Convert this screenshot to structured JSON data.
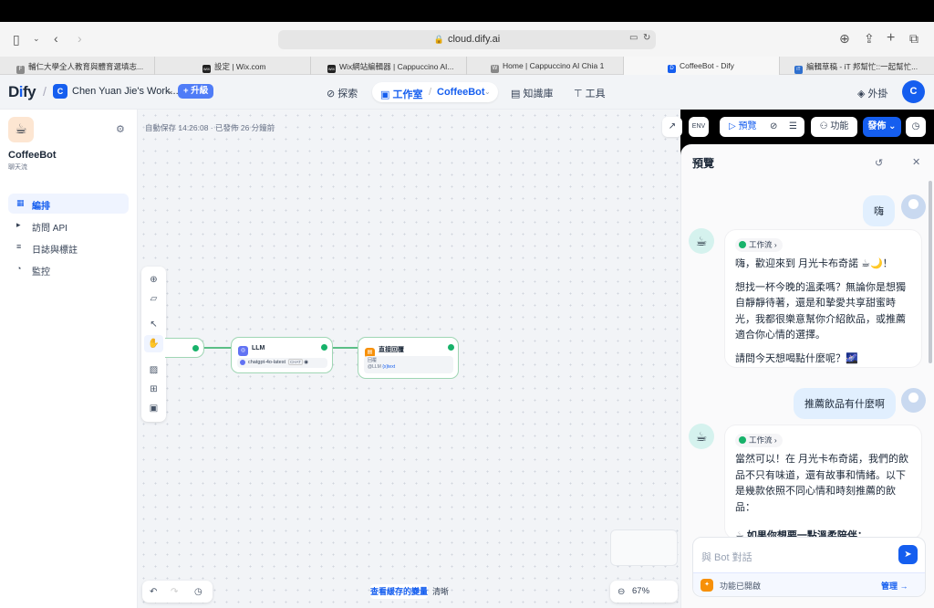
{
  "browser": {
    "url": "cloud.dify.ai",
    "tabs": [
      {
        "label": "輔仁大學全人教育與體育選填志...",
        "fav": "F",
        "fav_color": "#8a8a8a"
      },
      {
        "label": "設定 | Wix.com",
        "fav": "WiX",
        "fav_color": "#222222"
      },
      {
        "label": "Wix網站編輯器 | Cappuccino AI...",
        "fav": "WiX",
        "fav_color": "#222222"
      },
      {
        "label": "Home | Cappuccino AI Chia 1",
        "fav": "W",
        "fav_color": "#888888"
      },
      {
        "label": "CoffeeBot - Dify",
        "fav": "D",
        "fav_color": "#155eef"
      },
      {
        "label": "編輯草稿 - iT 邦幫忙::一起幫忙...",
        "fav": "iT",
        "fav_color": "#2e6fce"
      }
    ]
  },
  "header": {
    "logo_main": "D",
    "logo_i": "i",
    "logo_rest": "fy",
    "workspace_initial": "C",
    "workspace_name": "Chen Yuan Jie's Work...",
    "upgrade_label": "升級",
    "nav_explore": "探索",
    "nav_studio": "工作室",
    "nav_app": "CoffeeBot",
    "nav_knowledge": "知識庫",
    "nav_tools": "工具",
    "plugin_label": "外掛",
    "user_initial": "C"
  },
  "sidebar": {
    "app_name": "CoffeeBot",
    "app_type": "聊天流",
    "items": [
      {
        "label": "編排",
        "icon": "layout-icon"
      },
      {
        "label": "訪問 API",
        "icon": "terminal-icon"
      },
      {
        "label": "日誌與標註",
        "icon": "logs-icon"
      },
      {
        "label": "監控",
        "icon": "monitor-icon"
      }
    ]
  },
  "canvas": {
    "autosave": "自動保存 14:26:08 · 已發佈 26 分鐘前",
    "llm_node": {
      "title": "LLM",
      "model": "chatgpt-4o-latest",
      "tag": "CHAT"
    },
    "reply_node": {
      "title": "直接回覆",
      "label": "回覆",
      "var": "{x}text",
      "source": "@LLM"
    },
    "view_changes": "查看緩存的變量",
    "clear": "清晰",
    "zoom": "67%"
  },
  "actions": {
    "preview": "預覽",
    "features": "功能",
    "publish": "發佈"
  },
  "preview": {
    "title": "預覽",
    "messages": [
      {
        "role": "user",
        "text": "嗨"
      },
      {
        "role": "bot",
        "tag": "工作流",
        "paragraphs": [
          "嗨，歡迎來到 月光卡布奇諾 ☕🌙！",
          "想找一杯今晚的溫柔嗎？無論你是想獨自靜靜待著，還是和摯愛共享甜蜜時光，我都很樂意幫你介紹飲品，或推薦適合你心情的選擇。",
          "請問今天想喝點什麼呢？🌌"
        ]
      },
      {
        "role": "user",
        "text": "推薦飲品有什麼啊"
      },
      {
        "role": "bot",
        "tag": "工作流",
        "paragraphs": [
          "當然可以！在 月光卡布奇諾，我們的飲品不只有味道，還有故事和情緒。以下是幾款依照不同心情和時刻推薦的飲品：",
          "☕ 如果你想要一點溫柔陪伴："
        ]
      }
    ],
    "input_placeholder": "與 Bot 對話",
    "features_enabled": "功能已開啟",
    "manage": "管理"
  },
  "colors": {
    "brand": "#155eef",
    "success": "#17b26a"
  }
}
